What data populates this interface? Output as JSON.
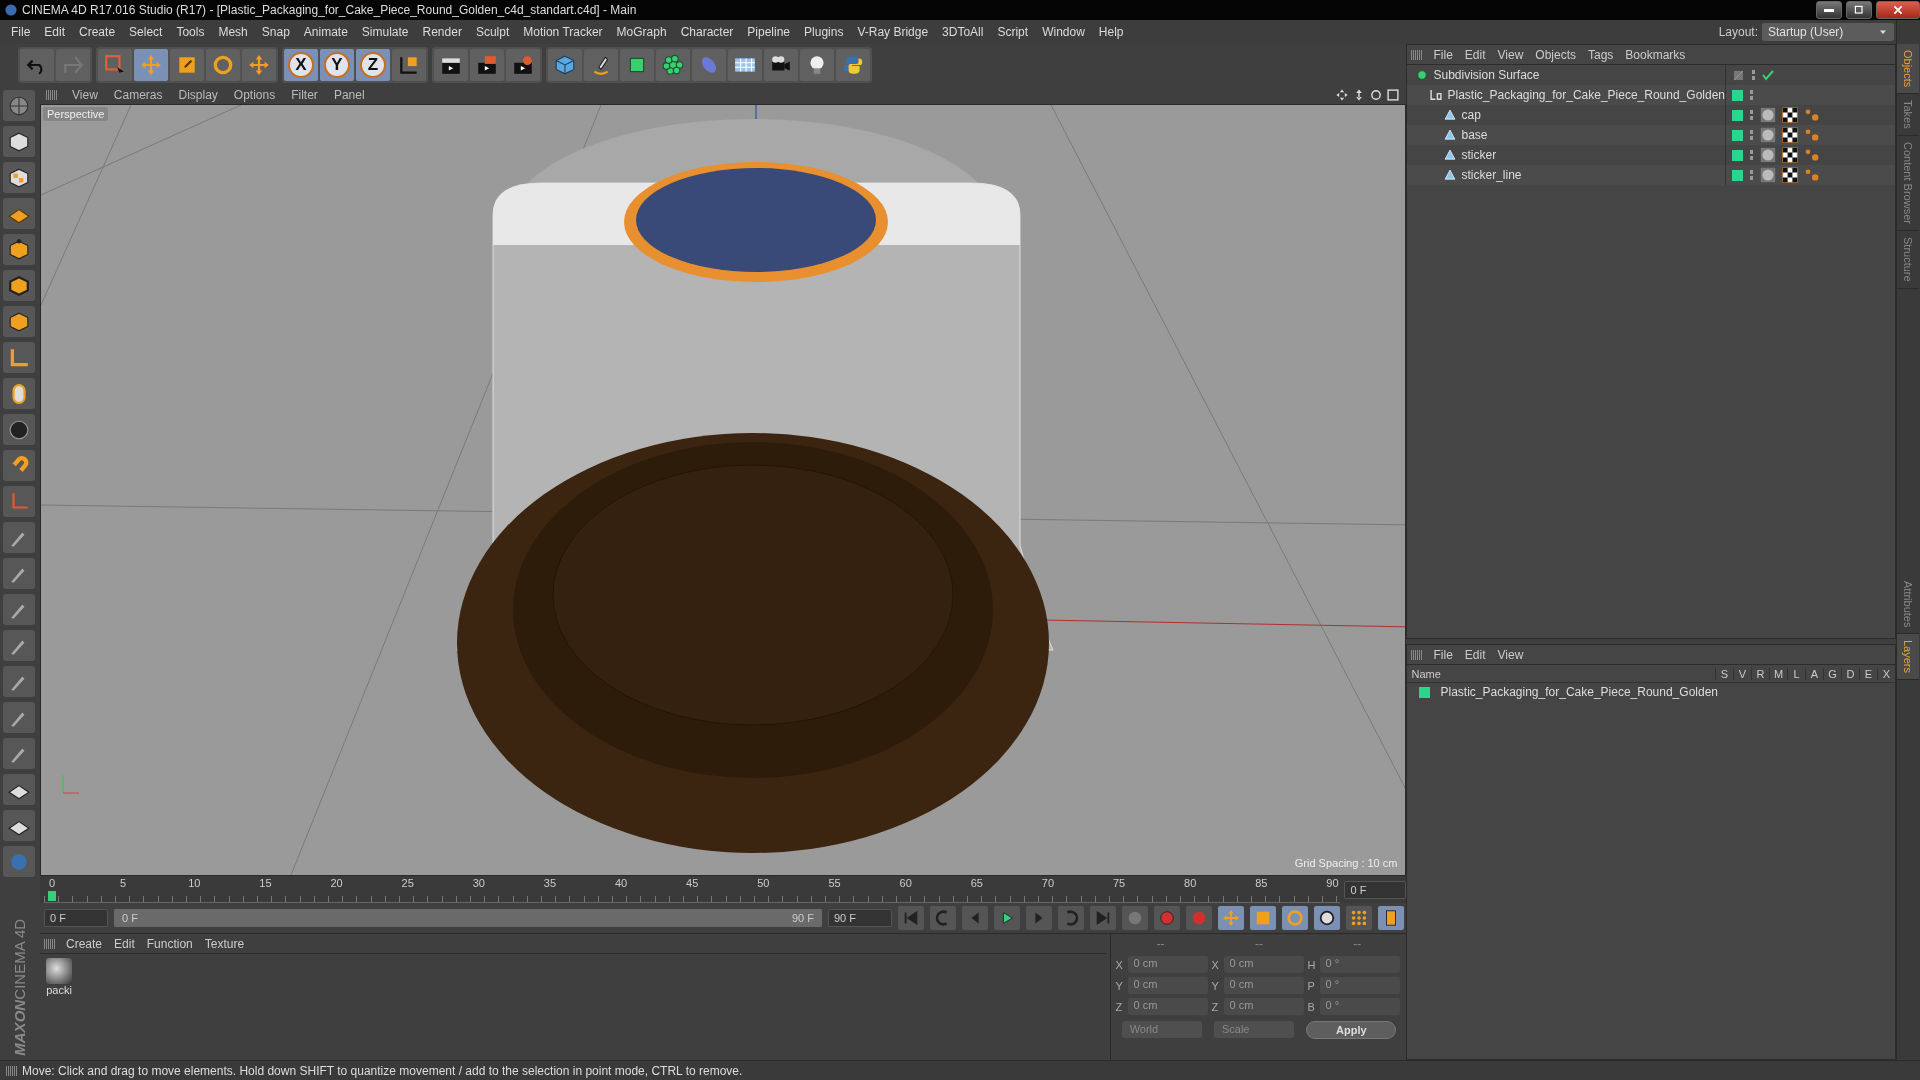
{
  "window": {
    "title": "CINEMA 4D R17.016 Studio (R17) - [Plastic_Packaging_for_Cake_Piece_Round_Golden_c4d_standart.c4d] - Main"
  },
  "menu": [
    "File",
    "Edit",
    "Create",
    "Select",
    "Tools",
    "Mesh",
    "Snap",
    "Animate",
    "Simulate",
    "Render",
    "Sculpt",
    "Motion Tracker",
    "MoGraph",
    "Character",
    "Pipeline",
    "Plugins",
    "V-Ray Bridge",
    "3DToAll",
    "Script",
    "Window",
    "Help"
  ],
  "layout": {
    "label": "Layout:",
    "value": "Startup (User)"
  },
  "axes": [
    "X",
    "Y",
    "Z"
  ],
  "viewport": {
    "menu": [
      "View",
      "Cameras",
      "Display",
      "Options",
      "Filter",
      "Panel"
    ],
    "camera": "Perspective",
    "grid_spacing": "Grid Spacing : 10 cm"
  },
  "timeline": {
    "ticks": [
      "0",
      "5",
      "10",
      "15",
      "20",
      "25",
      "30",
      "35",
      "40",
      "45",
      "50",
      "55",
      "60",
      "65",
      "70",
      "75",
      "80",
      "85",
      "90"
    ],
    "current": "0 F",
    "start": "0 F",
    "range": {
      "level": 1
    },
    "range_start": "0 F",
    "range_end": "90 F",
    "end": "90 F"
  },
  "materials": {
    "menu": [
      "Create",
      "Edit",
      "Function",
      "Texture"
    ],
    "items": [
      {
        "name": "packi"
      }
    ]
  },
  "coords": {
    "headers": [
      "--",
      "--",
      "--"
    ],
    "rows": [
      {
        "pos_axis": "X",
        "pos": "0 cm",
        "size_axis": "X",
        "size": "0 cm",
        "rot_axis": "H",
        "rot": "0 °"
      },
      {
        "pos_axis": "Y",
        "pos": "0 cm",
        "size_axis": "Y",
        "size": "0 cm",
        "rot_axis": "P",
        "rot": "0 °"
      },
      {
        "pos_axis": "Z",
        "pos": "0 cm",
        "size_axis": "Z",
        "size": "0 cm",
        "rot_axis": "B",
        "rot": "0 °"
      }
    ],
    "dropdowns": [
      "World",
      "Scale"
    ],
    "apply": "Apply"
  },
  "logo": {
    "brand": "MAXON",
    "product": "CINEMA 4D"
  },
  "status_bar": "Move: Click and drag to move elements. Hold down SHIFT to quantize movement / add to the selection in point mode, CTRL to remove.",
  "objects": {
    "menu": [
      "File",
      "Edit",
      "View",
      "Objects",
      "Tags",
      "Bookmarks"
    ],
    "tree": [
      {
        "name": "Subdivision Surface",
        "kind": "subdivision",
        "enabled": true,
        "children": [
          {
            "name": "Plastic_Packaging_for_Cake_Piece_Round_Golden",
            "kind": "null",
            "color": "#2ad58e",
            "children": [
              {
                "name": "cap",
                "kind": "polygon",
                "color": "#2ad58e"
              },
              {
                "name": "base",
                "kind": "polygon",
                "color": "#2ad58e"
              },
              {
                "name": "sticker",
                "kind": "polygon",
                "color": "#2ad58e"
              },
              {
                "name": "sticker_line",
                "kind": "polygon",
                "color": "#2ad58e"
              }
            ]
          }
        ]
      }
    ]
  },
  "layers": {
    "menu": [
      "File",
      "Edit",
      "View"
    ],
    "columns": [
      "Name",
      "S",
      "V",
      "R",
      "M",
      "L",
      "A",
      "G",
      "D",
      "E",
      "X"
    ],
    "rows": [
      {
        "name": "Plastic_Packaging_for_Cake_Piece_Round_Golden",
        "color": "#2ad58e"
      }
    ]
  },
  "side_tabs_top": [
    {
      "label": "Objects",
      "selected": true
    },
    {
      "label": "Takes",
      "selected": false
    },
    {
      "label": "Content Browser",
      "selected": false
    },
    {
      "label": "Structure",
      "selected": false
    }
  ],
  "side_tabs_bottom": [
    {
      "label": "Attributes",
      "selected": false
    },
    {
      "label": "Layers",
      "selected": true
    }
  ]
}
